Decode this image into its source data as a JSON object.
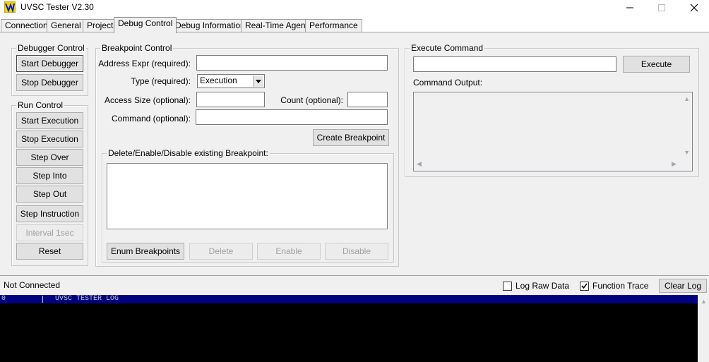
{
  "window": {
    "title": "UVSC Tester V2.30",
    "accent": "#0000ff"
  },
  "tabs": [
    {
      "label": "Connection",
      "active": false
    },
    {
      "label": "General",
      "active": false
    },
    {
      "label": "Project",
      "active": false
    },
    {
      "label": "Debug Control",
      "active": true
    },
    {
      "label": "Debug Information",
      "active": false
    },
    {
      "label": "Real-Time Agent",
      "active": false
    },
    {
      "label": "Performance",
      "active": false
    }
  ],
  "debugger_control": {
    "title": "Debugger Control",
    "start_label": "Start Debugger",
    "stop_label": "Stop Debugger"
  },
  "run_control": {
    "title": "Run Control",
    "start_execution": "Start Execution",
    "stop_execution": "Stop Execution",
    "step_over": "Step Over",
    "step_into": "Step Into",
    "step_out": "Step Out",
    "step_instruction": "Step Instruction",
    "interval": "Interval 1sec",
    "reset": "Reset"
  },
  "breakpoint_control": {
    "title": "Breakpoint Control",
    "address_label": "Address Expr (required):",
    "address_value": "",
    "type_label": "Type (required):",
    "type_value": "Execution",
    "access_size_label": "Access Size (optional):",
    "access_size_value": "",
    "count_label": "Count (optional):",
    "count_value": "",
    "command_label": "Command (optional):",
    "command_value": "",
    "create_label": "Create Breakpoint",
    "existing": {
      "title": "Delete/Enable/Disable existing Breakpoint:",
      "enum_label": "Enum Breakpoints",
      "delete_label": "Delete",
      "enable_label": "Enable",
      "disable_label": "Disable"
    }
  },
  "execute_command": {
    "title": "Execute Command",
    "command_value": "",
    "execute_label": "Execute",
    "output_label": "Command Output:"
  },
  "status": {
    "connection": "Not Connected",
    "log_raw_label": "Log Raw Data",
    "log_raw_checked": false,
    "function_trace_label": "Function Trace",
    "function_trace_checked": true,
    "clear_log_label": "Clear Log"
  },
  "log": {
    "header_index": "0",
    "header_text": "UVSC TESTER LOG"
  }
}
